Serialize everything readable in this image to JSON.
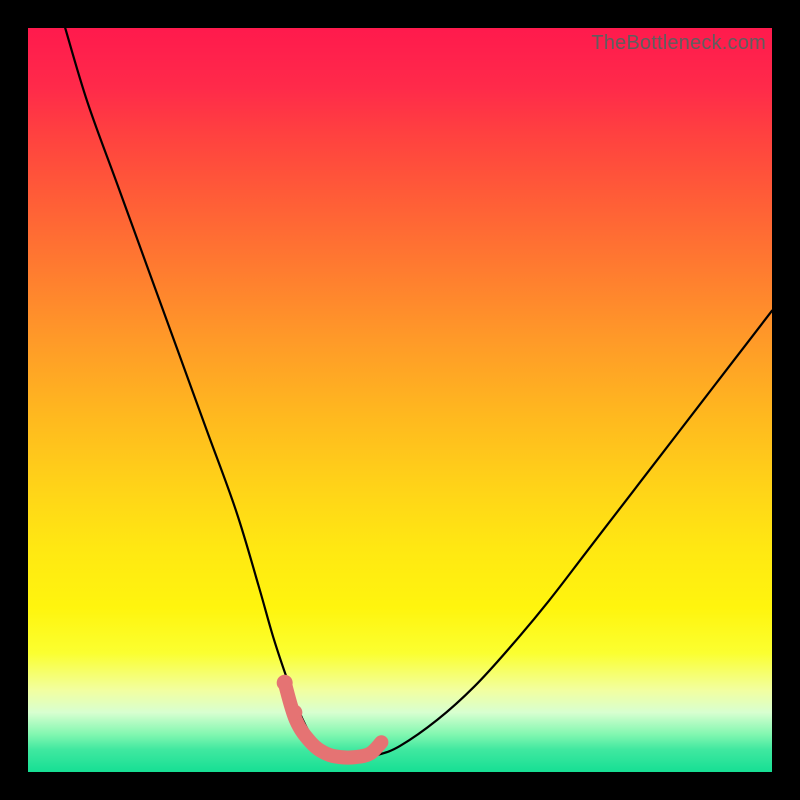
{
  "watermark": "TheBottleneck.com",
  "colors": {
    "background": "#000000",
    "curve": "#000000",
    "highlight": "#e57373"
  },
  "chart_data": {
    "type": "line",
    "title": "",
    "xlabel": "",
    "ylabel": "",
    "xlim": [
      0,
      100
    ],
    "ylim": [
      0,
      100
    ],
    "grid": false,
    "legend": false,
    "series": [
      {
        "name": "bottleneck-curve",
        "x": [
          5,
          8,
          12,
          16,
          20,
          24,
          28,
          31,
          33,
          35,
          36.5,
          38,
          39.5,
          41,
          43,
          45,
          47,
          50,
          55,
          60,
          65,
          70,
          75,
          80,
          85,
          90,
          95,
          100
        ],
        "y": [
          100,
          90,
          79,
          68,
          57,
          46,
          35,
          25,
          18,
          12,
          8,
          5,
          3,
          2.3,
          2,
          2,
          2.3,
          3.5,
          7,
          11.5,
          17,
          23,
          29.5,
          36,
          42.5,
          49,
          55.5,
          62
        ],
        "note": "Values are percentage of plot height from bottom, read approximately from pixel positions against the gradient; precision ~±2."
      },
      {
        "name": "optimal-range-highlight",
        "x": [
          34.5,
          36,
          38,
          40,
          42,
          44,
          46,
          47.5
        ],
        "y": [
          12,
          7,
          4,
          2.5,
          2,
          2,
          2.5,
          4
        ],
        "note": "Thick salmon segment near the curve minimum."
      }
    ],
    "markers": [
      {
        "name": "dot-left-1",
        "x": 34.5,
        "y": 12
      },
      {
        "name": "dot-left-2",
        "x": 35.8,
        "y": 8
      }
    ],
    "background_gradient": {
      "orientation": "vertical",
      "stops": [
        {
          "pos": 0.0,
          "color": "#ff1a4d"
        },
        {
          "pos": 0.5,
          "color": "#ffc91c"
        },
        {
          "pos": 0.8,
          "color": "#fff50e"
        },
        {
          "pos": 1.0,
          "color": "#16df94"
        }
      ]
    }
  }
}
